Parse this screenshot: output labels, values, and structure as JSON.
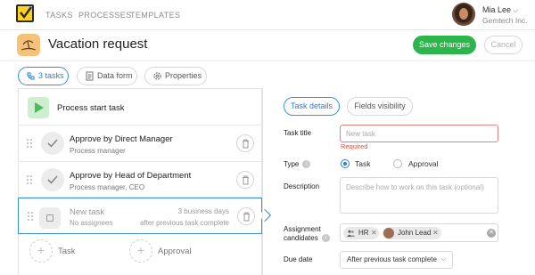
{
  "nav": {
    "items": [
      "TASKS",
      "PROCESSES",
      "TEMPLATES"
    ]
  },
  "user": {
    "name": "Mia Lee",
    "company": "Gemtech Inc."
  },
  "header": {
    "title": "Vacation request",
    "save_label": "Save changes",
    "cancel_label": "Cancel"
  },
  "tabs": {
    "tasks": "3 tasks",
    "data_form": "Data form",
    "properties": "Properties"
  },
  "tasklist": {
    "start": "Process start task",
    "tasks": [
      {
        "title": "Approve by Direct Manager",
        "subtitle": "Process manager"
      },
      {
        "title": "Approve by Head of Department",
        "subtitle": "Process manager, CEO"
      }
    ],
    "selected": {
      "title": "New task",
      "subtitle": "No assignees",
      "duration": "3 business days",
      "timing": "after previous task complete"
    },
    "add_task": "Task",
    "add_approval": "Approval"
  },
  "details": {
    "tabs": [
      "Task details",
      "Fields visibility"
    ],
    "task_title_label": "Task title",
    "task_title_placeholder": "New task",
    "required": "Required",
    "type_label": "Type",
    "type_options": [
      "Task",
      "Approval"
    ],
    "description_label": "Description",
    "description_placeholder": "Describe how to work on this task (optional)",
    "assignment_label_1": "Assignment",
    "assignment_label_2": "candidates",
    "chips": [
      "HR",
      "John Lead"
    ],
    "due_date_label": "Due date",
    "due_date_value": "After previous task complete"
  },
  "colors": {
    "accent": "#2a7fd0",
    "save": "#2bb54a",
    "error": "#e0504a",
    "logo": "#ffd21e",
    "process_icon": "#f6c27a"
  },
  "icons": [
    "logo-check-icon",
    "beach-icon",
    "flow-icon",
    "form-icon",
    "gear-icon",
    "play-icon",
    "check-icon",
    "trash-icon",
    "plus-icon",
    "info-icon",
    "chevron-down-icon",
    "clear-icon",
    "drag-handle-icon"
  ]
}
